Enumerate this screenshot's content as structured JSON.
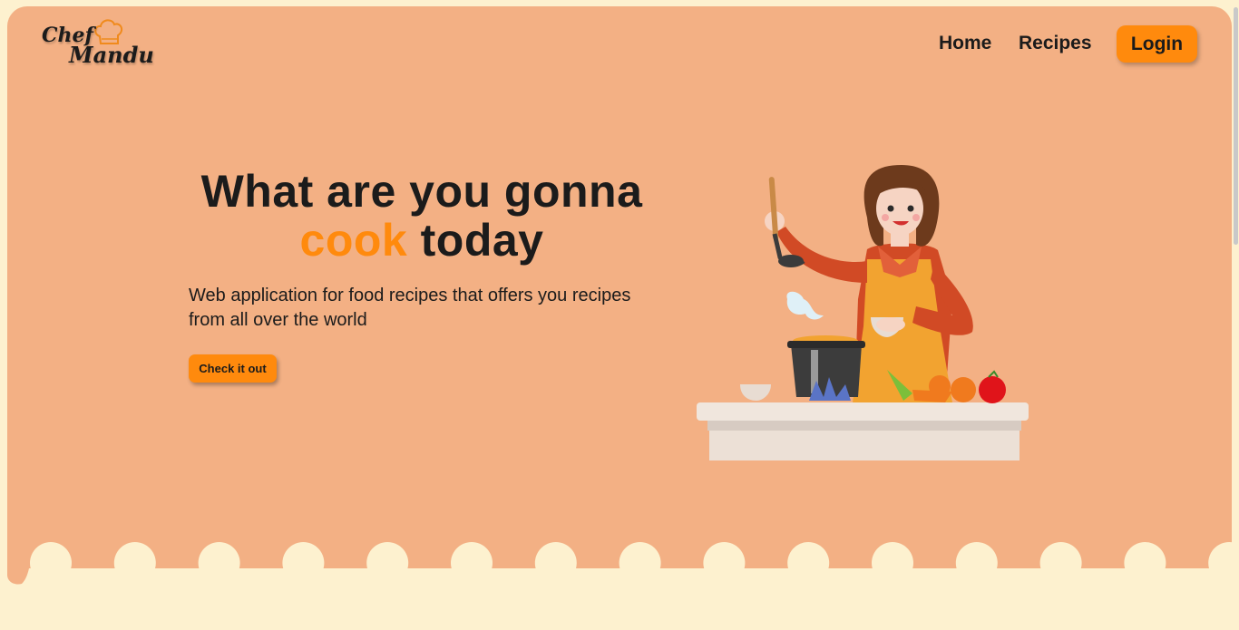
{
  "brand": {
    "logo_line1": "Chef",
    "logo_line2": "Mandu",
    "icon": "chef-hat-icon"
  },
  "nav": {
    "home_label": "Home",
    "recipes_label": "Recipes",
    "login_label": "Login"
  },
  "hero": {
    "headline_part1": "What are you gonna",
    "headline_accent": "cook",
    "headline_part2": "today",
    "subtitle": "Web application for food recipes that offers you recipes from all over the world",
    "cta_label": "Check it out",
    "illustration": "woman-cooking-illustration"
  },
  "colors": {
    "hero_background": "#f3b084",
    "page_background": "#fdf1cf",
    "accent": "#ff8a0d",
    "text": "#1b1b1b"
  }
}
